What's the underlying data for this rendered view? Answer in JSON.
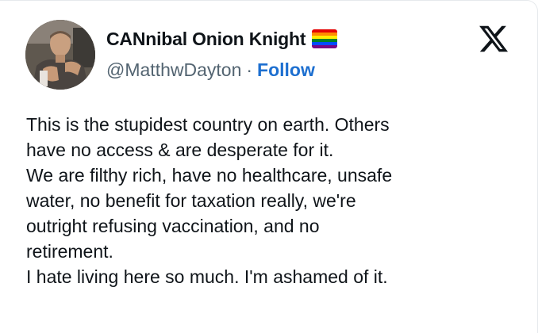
{
  "author": {
    "display_name": "CANnibal Onion Knight",
    "name_emoji": "rainbow-flag-icon",
    "handle": "@MatthwDayton",
    "separator": "·",
    "follow_label": "Follow"
  },
  "brand": {
    "logo_icon": "x-logo-icon"
  },
  "tweet": {
    "lines": [
      "This is the stupidest country on earth. Others",
      "have no access & are desperate for it.",
      "We are filthy rich, have no healthcare, unsafe",
      "water, no benefit for taxation really, we're",
      "outright refusing vaccination, and no",
      "retirement.",
      "I hate living here so much. I'm ashamed of it."
    ]
  },
  "colors": {
    "text": "#0f1419",
    "secondary_text": "#536471",
    "follow_link": "#1d6fd0",
    "flag": [
      "#e40303",
      "#ff8c00",
      "#ffed00",
      "#008026",
      "#004dff",
      "#750787"
    ]
  }
}
